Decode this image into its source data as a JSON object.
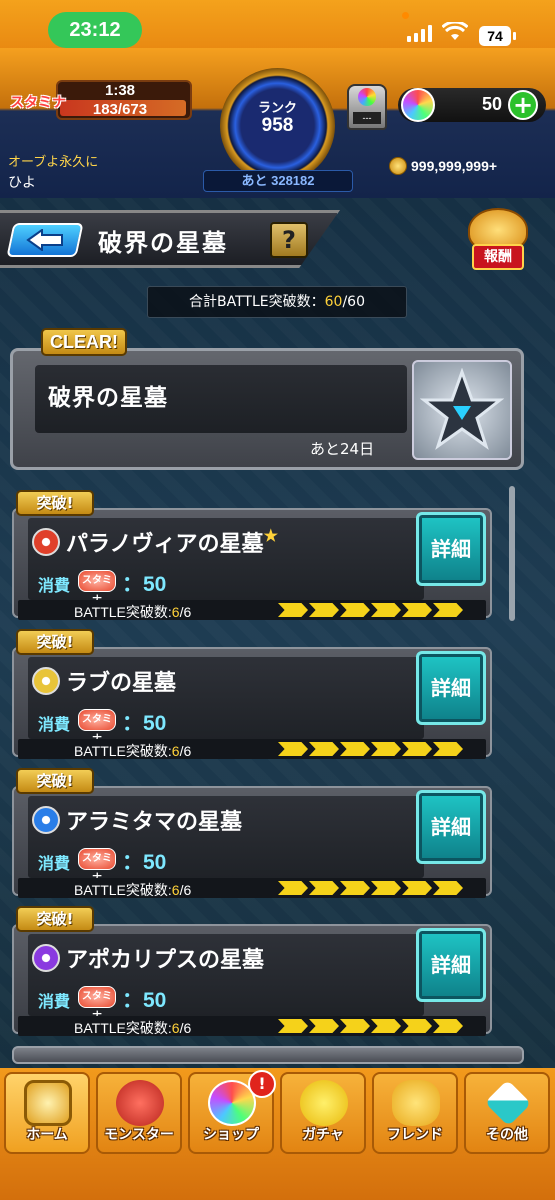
{
  "status_bar": {
    "time": "23:12",
    "battery": "74"
  },
  "header": {
    "stamina_label": "スタミナ",
    "stamina_timer": "1:38",
    "stamina_value": "183/673",
    "rank_label": "ランク",
    "rank_value": "958",
    "rank_next": "あと 328182",
    "orb_machine_label": "---",
    "orb_count": "50",
    "user_message": "オーブよ永久に",
    "user_name": "ひよ",
    "gold": "999,999,999+"
  },
  "title_bar": {
    "title": "破界の星墓",
    "help": "?",
    "reward_label": "報酬"
  },
  "summary": {
    "prefix": "合計BATTLE突破数：",
    "current": "60",
    "total": "/60"
  },
  "event": {
    "clear_badge": "CLEAR!",
    "title": "破界の星墓",
    "remaining": "あと24日"
  },
  "stages": [
    {
      "badge": "突破!",
      "name": "パラノヴィアの星墓",
      "star": "★",
      "cost_label": "消費",
      "stamina_chip": "スタミナ",
      "cost": "：50",
      "detail": "詳細",
      "progress_label": "BATTLE突破数:",
      "progress_current": "6",
      "progress_total": "/6",
      "element_color": "#e0402a",
      "progress": 1.0
    },
    {
      "badge": "突破!",
      "name": "ラブの星墓",
      "star": "",
      "cost_label": "消費",
      "stamina_chip": "スタミナ",
      "cost": "：50",
      "detail": "詳細",
      "progress_label": "BATTLE突破数:",
      "progress_current": "6",
      "progress_total": "/6",
      "element_color": "#e8c43a",
      "progress": 1.0
    },
    {
      "badge": "突破!",
      "name": "アラミタマの星墓",
      "star": "",
      "cost_label": "消費",
      "stamina_chip": "スタミナ",
      "cost": "：50",
      "detail": "詳細",
      "progress_label": "BATTLE突破数:",
      "progress_current": "6",
      "progress_total": "/6",
      "element_color": "#2a7ee8",
      "progress": 1.0
    },
    {
      "badge": "突破!",
      "name": "アポカリプスの星墓",
      "star": "",
      "cost_label": "消費",
      "stamina_chip": "スタミナ",
      "cost": "：50",
      "detail": "詳細",
      "progress_label": "BATTLE突破数:",
      "progress_current": "6",
      "progress_total": "/6",
      "element_color": "#8a3ae0",
      "progress": 1.0
    }
  ],
  "bottom_nav": [
    {
      "label": "ホーム",
      "icon": "home-icon",
      "active": true
    },
    {
      "label": "モンスター",
      "icon": "monster-icon",
      "active": false
    },
    {
      "label": "ショップ",
      "icon": "shop-orb-icon",
      "active": false,
      "notify": "!"
    },
    {
      "label": "ガチャ",
      "icon": "gacha-icon",
      "active": false
    },
    {
      "label": "フレンド",
      "icon": "friend-icon",
      "active": false
    },
    {
      "label": "その他",
      "icon": "other-icon",
      "active": false
    }
  ],
  "colors": {
    "accent_gold": "#ffd23a",
    "detail_cyan": "#1fc6c6",
    "cost_cyan": "#7ee8ff"
  }
}
